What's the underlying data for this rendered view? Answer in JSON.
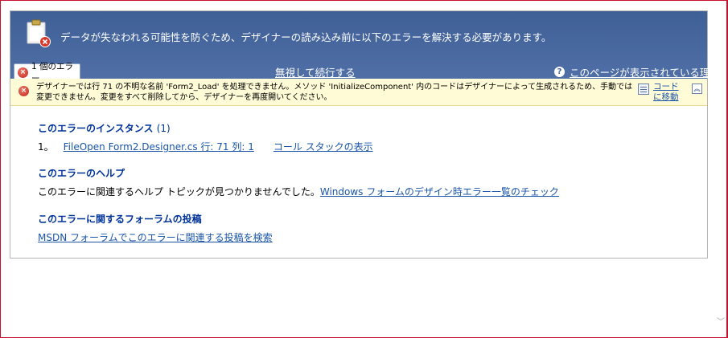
{
  "header": {
    "message": "データが失なわれる可能性を防ぐため、デザイナーの読み込み前に以下のエラーを解決する必要があります。",
    "tab_label": "1 個のエラー",
    "ignore_link": "無視して続行する",
    "why_link": "このページが表示されている理由"
  },
  "error": {
    "message": "デザイナーでは行 71 の不明な名前 'Form2_Load' を処理できません。メソッド 'InitializeComponent' 内のコードはデザイナーによって生成されるため、手動では変更できません。変更をすべて削除してから、デザイナーを再度開いてください。",
    "goto_code_label": "コードに移動"
  },
  "instances": {
    "title": "このエラーのインスタンス",
    "count": "(1)",
    "items": [
      {
        "number": "1。",
        "location": "FileOpen Form2.Designer.cs 行: 71 列: 1",
        "call_stack": "コール スタックの表示"
      }
    ]
  },
  "help": {
    "title": "このエラーのヘルプ",
    "text": "このエラーに関連するヘルプ トピックが見つかりませんでした。",
    "link": "Windows フォームのデザイン時エラー一覧のチェック"
  },
  "forum": {
    "title": "このエラーに関するフォーラムの投稿",
    "link": "MSDN フォーラムでこのエラーに関連する投稿を検索"
  },
  "icons": {
    "header": "clipboard-error-icon",
    "error": "error-icon",
    "help": "help-icon",
    "goto_code": "code-file-icon",
    "collapse": "collapse-icon",
    "scroll": "scroll-down-arrow"
  },
  "colors": {
    "header_bg": "#4a6aa1",
    "error_bar_bg": "#fffbd6",
    "link": "#1a55a8",
    "section_title": "#003399",
    "frame_border": "#c8102e"
  }
}
